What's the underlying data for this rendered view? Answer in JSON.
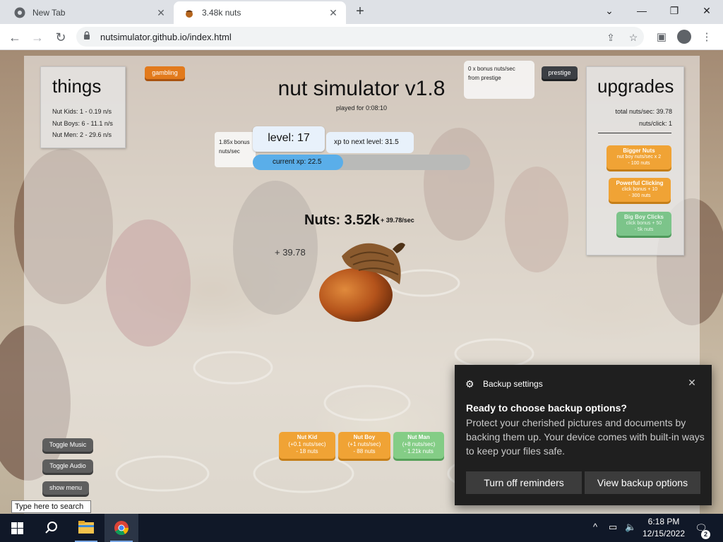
{
  "browser": {
    "tabs": [
      {
        "title": "New Tab",
        "icon": "chrome-icon",
        "close": "✕"
      },
      {
        "title": "3.48k nuts",
        "icon": "nut-favicon",
        "close": "✕"
      }
    ],
    "new_tab": "+",
    "window_controls": {
      "dropdown": "⌄",
      "minimize": "—",
      "restore": "❐",
      "close": "✕"
    },
    "url": "nutsimulator.github.io/index.html"
  },
  "game": {
    "things": {
      "title": "things",
      "lines": [
        "Nut Kids: 1 - 0.19 n/s",
        "Nut Boys: 6 - 11.1 n/s",
        "Nut Men: 2 - 29.6 n/s"
      ]
    },
    "gambling_label": "gambling",
    "title": "nut simulator v1.8",
    "played_for": "played for 0:08:10",
    "prestige_bonus": [
      "0 x bonus nuts/sec",
      "from prestige"
    ],
    "prestige_label": "prestige",
    "upgrades": {
      "title": "upgrades",
      "total_rate": "total nuts/sec: 39.78",
      "per_click": "nuts/click: 1",
      "items": [
        {
          "name": "Bigger Nuts",
          "desc": "nut boy nuts/sec x 2",
          "cost": "- 100 nuts",
          "color": "#f0a335"
        },
        {
          "name": "Powerful Clicking",
          "desc": "click bonus + 10",
          "cost": "- 300 nuts",
          "color": "#f0a335"
        },
        {
          "name": "Big Boy Clicks",
          "desc": "click bonus + 50",
          "cost": "- 5k nuts",
          "color": "#7cc48a"
        }
      ]
    },
    "level": {
      "bonus": [
        "1.85x bonus",
        "nuts/sec"
      ],
      "label": "level: 17",
      "xp_next": "xp to next level: 31.5",
      "current_xp": "current xp: 22.5",
      "xp_progress": 0.417
    },
    "nuts": {
      "count": "Nuts: 3.52k",
      "rate": "+ 39.78/sec",
      "click_popup": "+ 39.78"
    },
    "buy": [
      {
        "name": "Nut Kid",
        "rate": "(+0.1 nuts/sec)",
        "cost": "- 18 nuts",
        "color": "#f0a335"
      },
      {
        "name": "Nut Boy",
        "rate": "(+1 nuts/sec)",
        "cost": "- 88 nuts",
        "color": "#f0a335"
      },
      {
        "name": "Nut Man",
        "rate": "(+8 nuts/sec)",
        "cost": "- 1.21k nuts",
        "color": "#84cd86"
      }
    ],
    "controls": {
      "music": "Toggle Music",
      "audio": "Toggle Audio",
      "menu": "show menu"
    }
  },
  "search_tooltip": "Type here to search",
  "toast": {
    "header": "Backup settings",
    "title": "Ready to choose backup options?",
    "body": "Protect your cherished pictures and documents by backing them up. Your device comes with built-in ways to keep your files safe.",
    "button_reminders": "Turn off reminders",
    "button_view": "View backup options",
    "close": "✕"
  },
  "taskbar": {
    "time": "6:18 PM",
    "date": "12/15/2022",
    "notification_count": "2",
    "tray_chevron": "^"
  }
}
